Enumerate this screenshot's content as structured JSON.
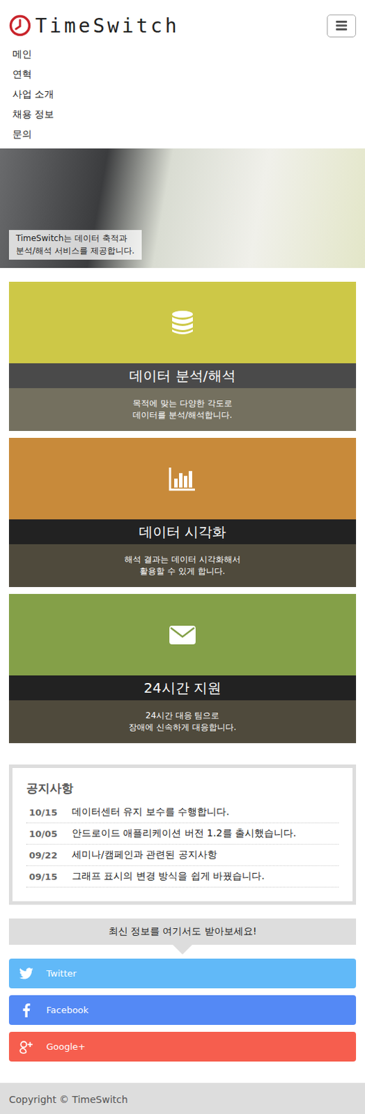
{
  "header": {
    "logo": "TimeSwitch"
  },
  "nav": {
    "items": [
      "메인",
      "연혁",
      "사업 소개",
      "채용 정보",
      "문의"
    ]
  },
  "hero": {
    "caption": [
      "TimeSwitch는 데이터 축적과",
      "분석/해석 서비스를 제공합니다."
    ]
  },
  "features": [
    {
      "title": "데이터 분석/해석",
      "desc": [
        "목적에 맞는 다양한 각도로",
        "데이터를 분석/해석합니다."
      ],
      "color": "#cdc847",
      "titleColor": "#4a4a4a",
      "descColor": "#74705f"
    },
    {
      "title": "데이터 시각화",
      "desc": [
        "해석 결과는 데이터 시각화해서",
        "활용할 수 있게 합니다."
      ],
      "color": "#c88a3a",
      "titleColor": "#222222",
      "descColor": "#4f4a3c"
    },
    {
      "title": "24시간 지원",
      "desc": [
        "24시간 대응 팀으로",
        "장애에 신속하게 대응합니다."
      ],
      "color": "#84a048",
      "titleColor": "#222222",
      "descColor": "#4f4a3c"
    }
  ],
  "notices": {
    "title": "공지사항",
    "items": [
      {
        "date": "10/15",
        "text": "데이터센터 유지 보수를 수행합니다."
      },
      {
        "date": "10/05",
        "text": "안드로이드 애플리케이션 버전 1.2를 출시했습니다."
      },
      {
        "date": "09/22",
        "text": "세미나/캠페인과 관련된 공지사항"
      },
      {
        "date": "09/15",
        "text": "그래프 표시의 변경 방식을 쉽게 바꿨습니다."
      }
    ]
  },
  "social": {
    "heading": "최신 정보를 여기서도 받아보세요!",
    "buttons": [
      {
        "label": "Twitter",
        "color": "#61b9f8"
      },
      {
        "label": "Facebook",
        "color": "#5489f5"
      },
      {
        "label": "Google+",
        "color": "#f65e4e"
      }
    ]
  },
  "footer": {
    "text": "Copyright © TimeSwitch"
  }
}
